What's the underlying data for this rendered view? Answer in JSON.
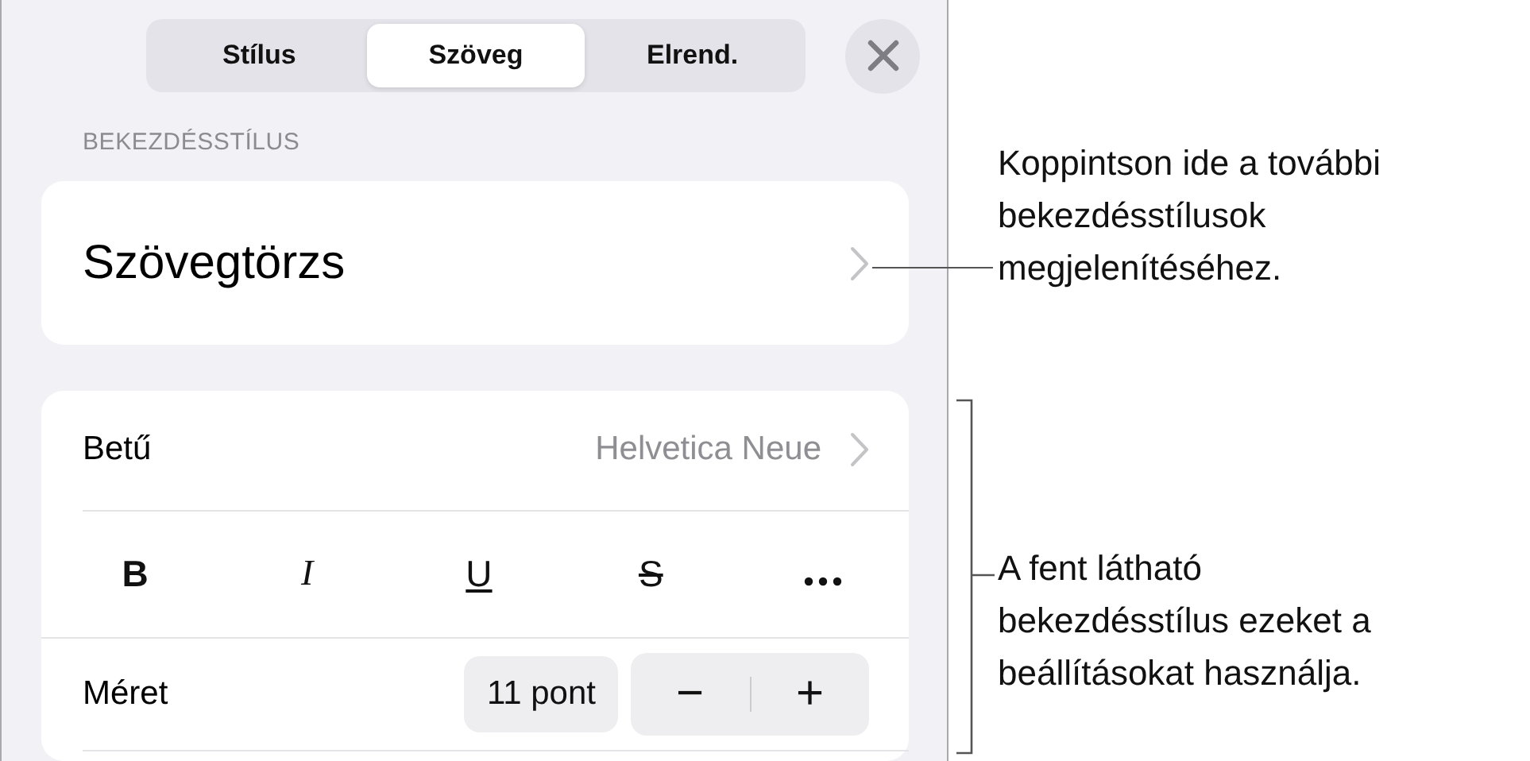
{
  "tabs": [
    {
      "label": "Stílus",
      "selected": false
    },
    {
      "label": "Szöveg",
      "selected": true
    },
    {
      "label": "Elrend.",
      "selected": false
    }
  ],
  "section_header": "BEKEZDÉSSTÍLUS",
  "paragraph_style": {
    "value": "Szövegtörzs"
  },
  "font_row": {
    "label": "Betű",
    "value": "Helvetica Neue"
  },
  "format_buttons": [
    {
      "label": "B",
      "kind": "bold"
    },
    {
      "label": "I",
      "kind": "italic"
    },
    {
      "label": "U",
      "kind": "underline"
    },
    {
      "label": "S",
      "kind": "strike"
    },
    {
      "kind": "more"
    }
  ],
  "size_row": {
    "label": "Méret",
    "value": "11 pont",
    "decrease": "−",
    "increase": "+"
  },
  "callouts": [
    {
      "kind": "pointer",
      "lines": [
        "Koppintson ide a további",
        "bekezdésstílusok",
        "megjelenítéséhez."
      ]
    },
    {
      "kind": "bracket",
      "lines": [
        "A fent látható",
        "bekezdésstílus ezeket a",
        "beállításokat használja."
      ]
    }
  ]
}
